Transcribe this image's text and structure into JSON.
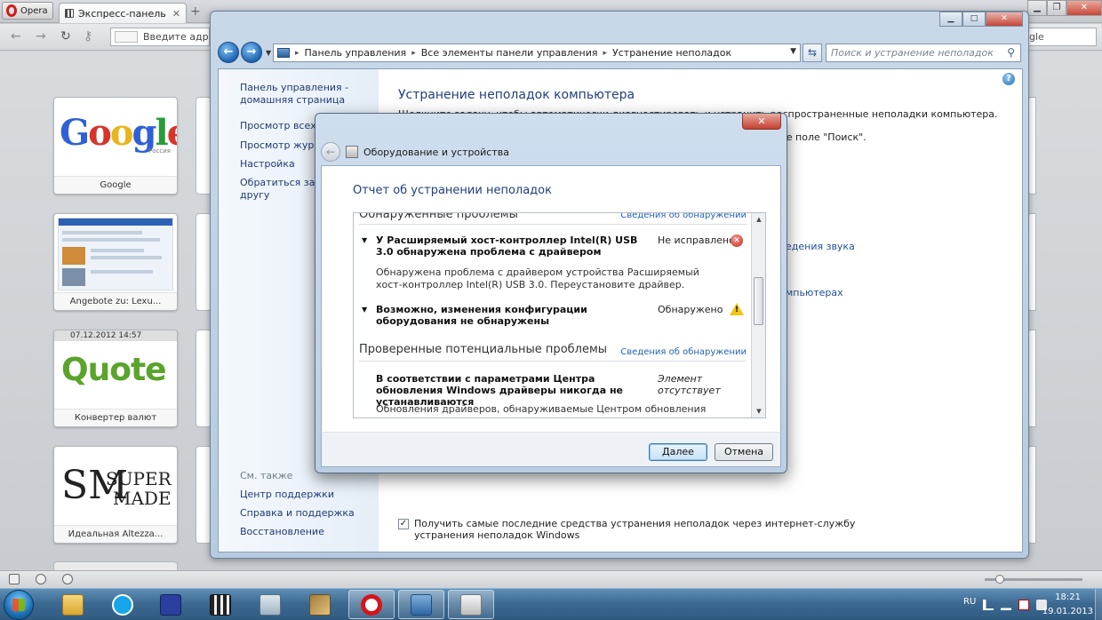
{
  "opera": {
    "menu_label": "Opera",
    "tab_title": "Экспресс-панель",
    "tab_close": "✕",
    "new_tab": "+",
    "address_placeholder": "Введите адрес",
    "search_value": "gle",
    "speed_dial": [
      {
        "caption": "Google",
        "logo_sub": "Россия"
      },
      {
        "caption": "Angebote zu: Lexu..."
      },
      {
        "caption": "Конвертер валют",
        "date": "07.12.2012 14:57",
        "logo": "Quote"
      },
      {
        "caption": "Идеальная Altezza...",
        "logo_line1": "SUPER",
        "logo_line2": "MADE",
        "logo_mark": "SM"
      }
    ]
  },
  "explorer": {
    "breadcrumb": [
      "Панель управления",
      "Все элементы панели управления",
      "Устранение неполадок"
    ],
    "search_placeholder": "Поиск и устранение неполадок",
    "sidebar_top": [
      "Панель управления -",
      "домашняя страница",
      "Просмотр всех к",
      "Просмотр журна",
      "Настройка",
      "Обратиться за по",
      "другу"
    ],
    "see_also_header": "См. также",
    "see_also": [
      "Центр поддержки",
      "Справка и поддержка",
      "Восстановление"
    ],
    "main_title": "Устранение неполадок компьютера",
    "main_desc_line1": "Щелкните задачу, чтобы автоматически диагностировать и устранить распространенные неполадки компьютера. Для использования",
    "main_desc_line2": "ее поле \"Поиск\".",
    "link_sound": "едения звука",
    "link_computers": "мпьютерах",
    "checkbox_label": "Получить самые последние средства устранения неполадок через интернет-службу устранения неполадок Windows"
  },
  "dialog": {
    "header": "Оборудование и устройства",
    "title": "Отчет об устранении неполадок",
    "section1_title": "Обнаруженные проблемы",
    "section1_link": "Сведения об обнаружении",
    "issue1_title": "У Расширяемый хост-контроллер Intel(R) USB 3.0 обнаружена проблема с драйвером",
    "issue1_status": "Не исправлено",
    "issue1_desc": "Обнаружена проблема с драйвером устройства Расширяемый хост-контроллер Intel(R) USB 3.0. Переустановите драйвер.",
    "issue2_title": "Возможно, изменения конфигурации оборудования не обнаружены",
    "issue2_status": "Обнаружено",
    "section2_title": "Проверенные потенциальные проблемы",
    "section2_link": "Сведения об обнаружении",
    "issue3_title": "В соответствии с параметрами Центра обновления Windows драйверы никогда не устанавливаются",
    "issue3_status_line1": "Элемент",
    "issue3_status_line2": "отсутствует",
    "issue3_desc": "Обновления драйверов, обнаруживаемые Центром обновления Windows,",
    "next_button": "Далее",
    "cancel_button": "Отмена"
  },
  "taskbar": {
    "lang": "RU",
    "time": "18:21",
    "date": "19.01.2013"
  }
}
